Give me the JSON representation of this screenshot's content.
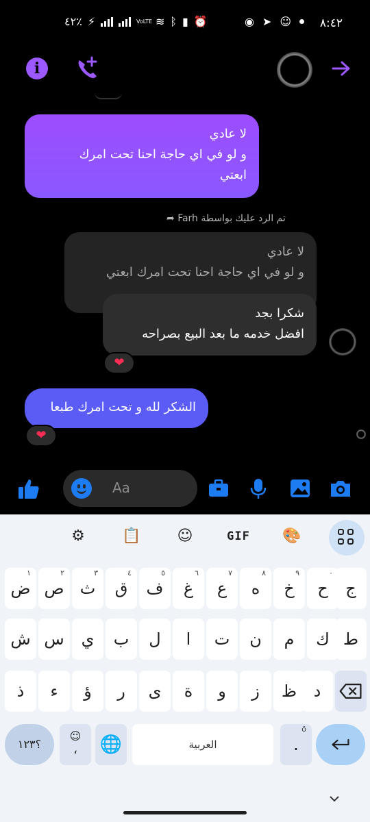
{
  "status_bar": {
    "time": "٨:٤٢",
    "battery": "٤٢٪",
    "volte": "VoLTE"
  },
  "header": {
    "info_icon": "info-icon",
    "call_icon": "add-call-icon",
    "back_icon": "arrow-right-icon"
  },
  "messages": [
    {
      "lines": [
        "لا عادي",
        "و لو في اي حاجة احنا تحت امرك",
        "ابعتي"
      ],
      "side": "sent"
    },
    {
      "reply_label": "تم الرد عليك بواسطة Farh"
    },
    {
      "quoted_lines": [
        "لا عادي",
        "و لو في اي حاجة احنا تحت امرك ابعتي"
      ]
    },
    {
      "lines": [
        "شكرا بجد",
        "افضل خدمه ما بعد البيع بصراحه"
      ],
      "side": "received",
      "reaction": "❤"
    },
    {
      "lines": [
        "الشكر لله و تحت امرك طبعا"
      ],
      "side": "sent",
      "reaction": "❤"
    }
  ],
  "composer": {
    "placeholder": "Aa"
  },
  "keyboard": {
    "toolbar_gif": "GIF",
    "row1": [
      {
        "k": "ض",
        "h": "١"
      },
      {
        "k": "ص",
        "h": "٢"
      },
      {
        "k": "ث",
        "h": "٣"
      },
      {
        "k": "ق",
        "h": "٤"
      },
      {
        "k": "ف",
        "h": "٥"
      },
      {
        "k": "غ",
        "h": "٦"
      },
      {
        "k": "ع",
        "h": "٧"
      },
      {
        "k": "ه",
        "h": "٨"
      },
      {
        "k": "خ",
        "h": "٩"
      },
      {
        "k": "ح",
        "h": "٠"
      },
      {
        "k": "ج",
        "h": ""
      }
    ],
    "row2": [
      "ش",
      "س",
      "ي",
      "ب",
      "ل",
      "ا",
      "ت",
      "ن",
      "م",
      "ك",
      "ط"
    ],
    "row3": [
      "ذ",
      "ء",
      "ؤ",
      "ر",
      "ى",
      "ة",
      "و",
      "ز",
      "ظ",
      "د"
    ],
    "sym_label": "؟١٢٣",
    "emoji_comma": "،",
    "space_label": "العربية",
    "period": ".",
    "period_hint": "ö"
  },
  "colors": {
    "accent_purple": "#9b59ff",
    "accent_blue": "#1e7cf2",
    "sent_gradient_top": "#9d4dff",
    "sent_blue": "#5b5cf6",
    "received": "#2e2e2e"
  }
}
